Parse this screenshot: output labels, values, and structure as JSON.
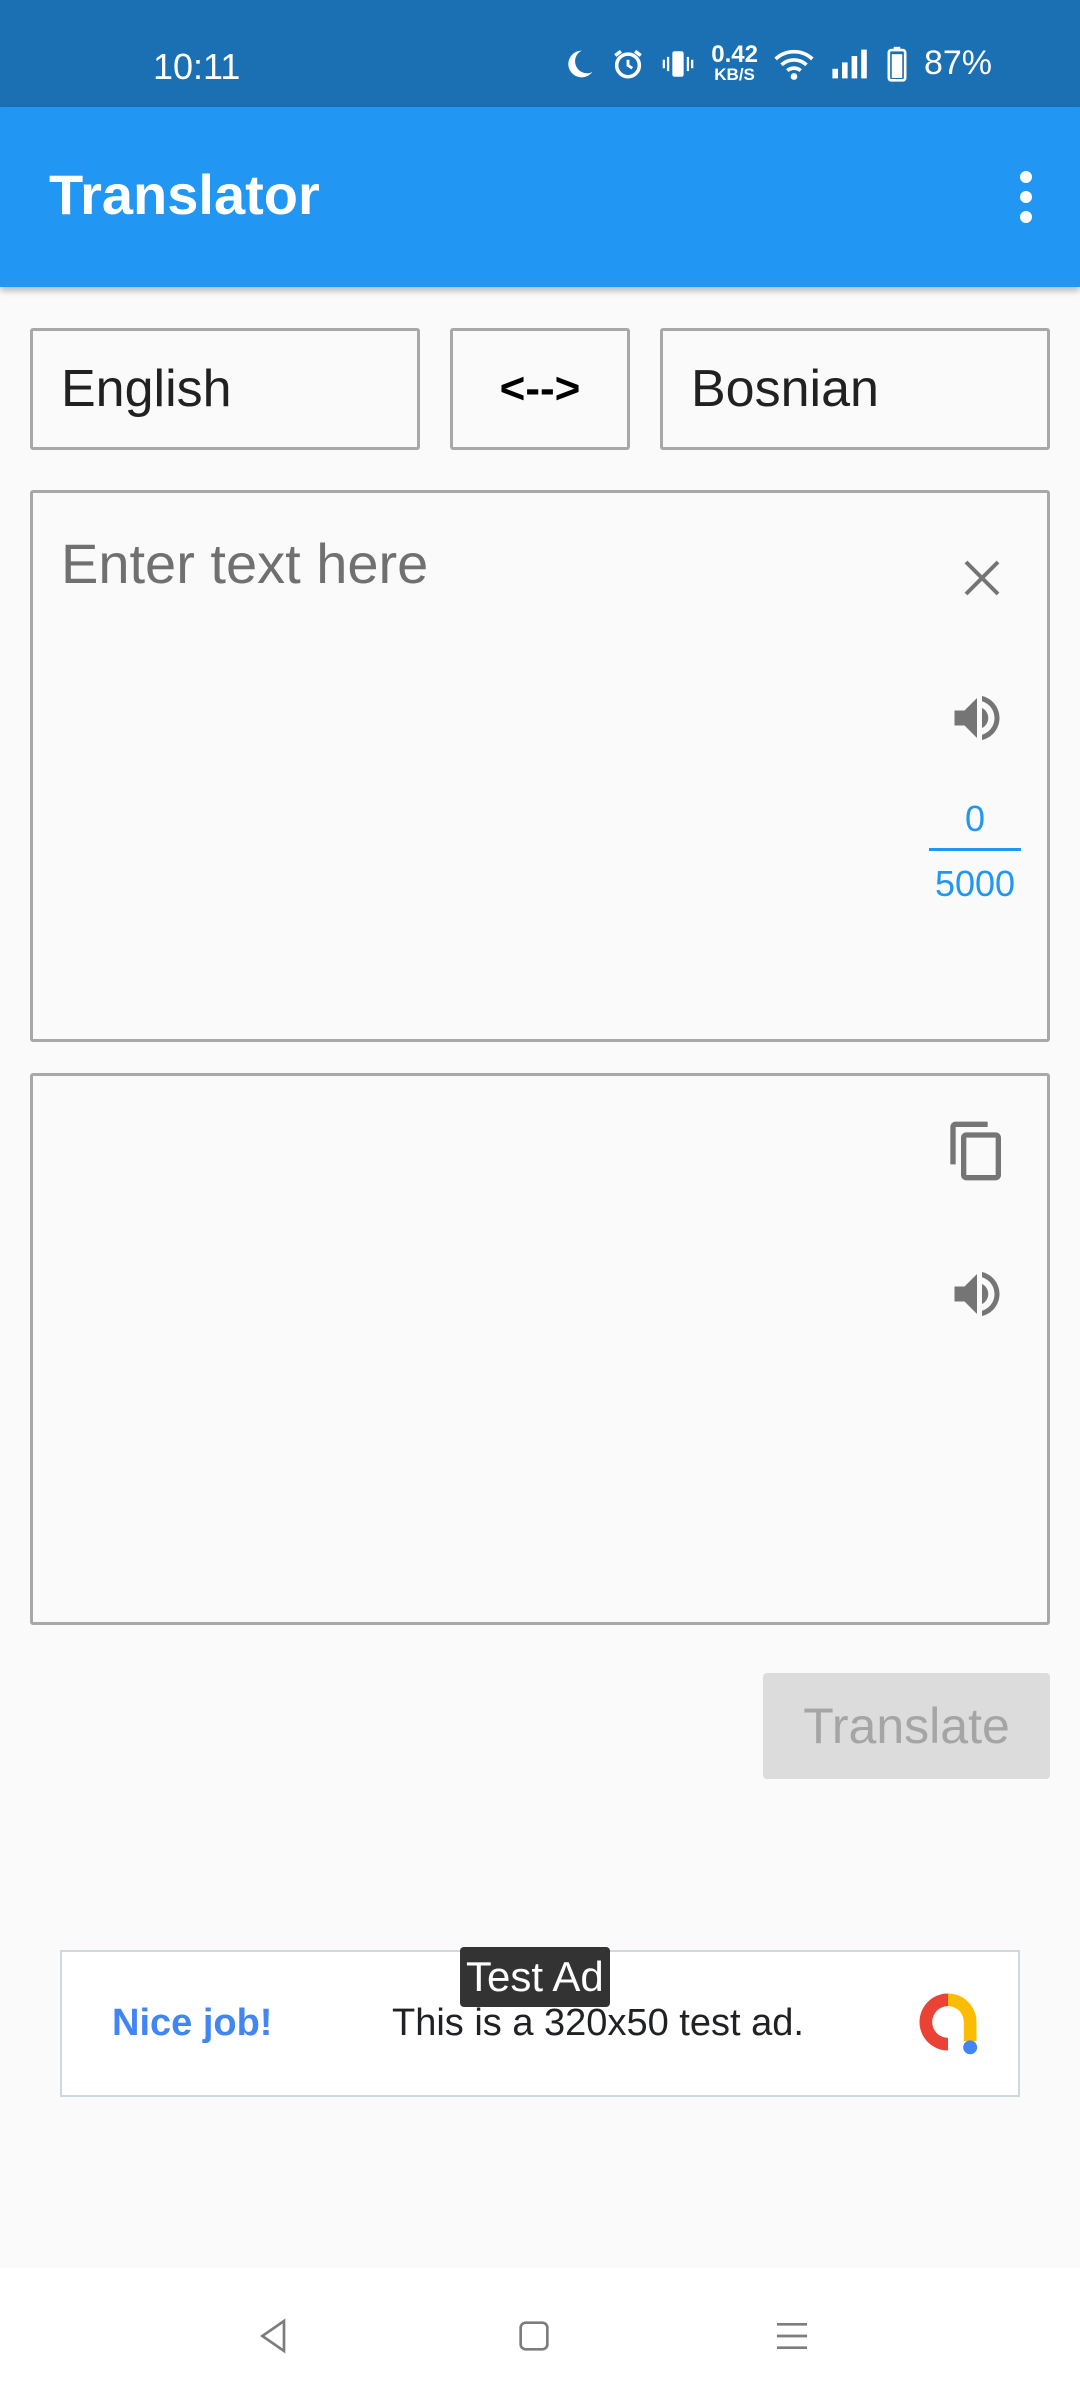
{
  "status_bar": {
    "time": "10:11",
    "net_speed_value": "0.42",
    "net_speed_unit": "KB/S",
    "battery": "87%",
    "icons": [
      "moon-icon",
      "alarm-icon",
      "vibrate-icon",
      "wifi-icon",
      "signal-icon",
      "battery-icon"
    ]
  },
  "app_bar": {
    "title": "Translator",
    "menu_icon": "more-vert-icon"
  },
  "languages": {
    "source": "English",
    "swap_label": "<-->",
    "target": "Bosnian"
  },
  "input": {
    "placeholder": "Enter text here",
    "value": "",
    "char_count": "0",
    "char_limit": "5000"
  },
  "output": {
    "value": ""
  },
  "translate_button": {
    "label": "Translate",
    "enabled": false
  },
  "ad": {
    "badge": "Test Ad",
    "headline": "Nice job!",
    "body": "This is a 320x50 test ad."
  },
  "colors": {
    "status_bar": "#1b6fb3",
    "app_bar": "#2196f3",
    "accent": "#2196f3",
    "border": "#a8a8a8",
    "disabled_button": "#dcdcdc"
  }
}
